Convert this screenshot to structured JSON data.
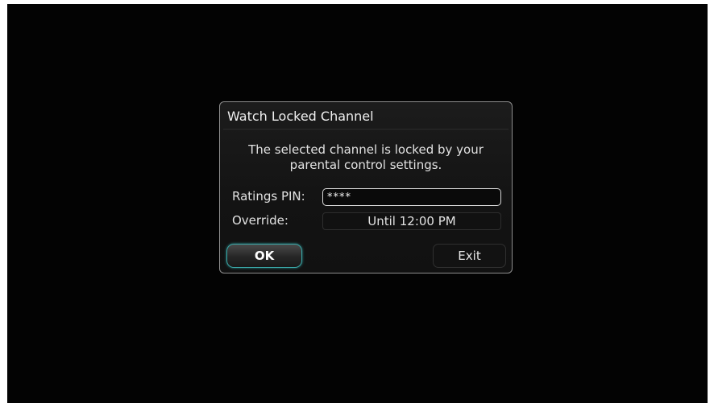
{
  "dialog": {
    "title": "Watch Locked Channel",
    "message": "The selected channel is locked by your parental control settings.",
    "pin": {
      "label": "Ratings PIN:",
      "value": "****"
    },
    "override": {
      "label": "Override:",
      "value": "Until 12:00 PM"
    },
    "buttons": {
      "ok_label": "OK",
      "exit_label": "Exit"
    }
  },
  "colors": {
    "background": "#030303",
    "focus_accent": "#3aa7a7",
    "dialog_border": "#8e8e8e"
  }
}
